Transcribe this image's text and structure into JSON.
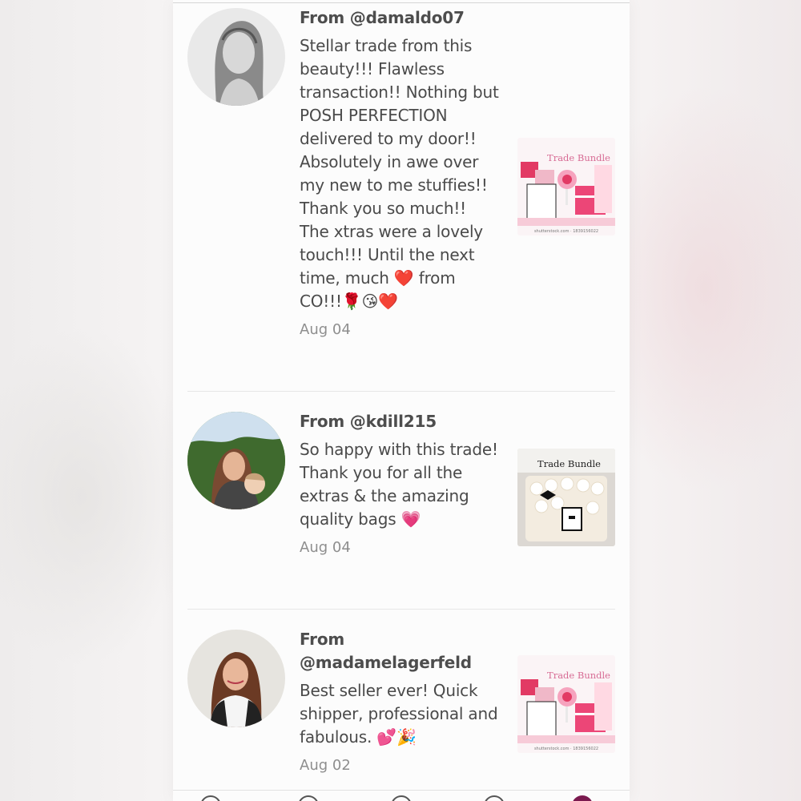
{
  "reviews": [
    {
      "from": "From @damaldo07",
      "body": "Stellar trade from this beauty!!! Flawless transaction!! Nothing but POSH PERFECTION delivered to my door!! Absolutely in awe over my new to me stuffies!! Thank you so much!! The xtras were a lovely touch!!! Until the next time, much ❤️ from CO!!!🌹😘❤️",
      "date": "Aug 04",
      "thumb_label": "Trade Bundle",
      "thumb_caption": "shutterstock.com · 1839156022"
    },
    {
      "from": "From @kdill215",
      "body": "So happy with this trade! Thank you for all the extras & the amazing quality bags 💗",
      "date": "Aug 04",
      "thumb_label": "Trade Bundle"
    },
    {
      "from": "From @madamelagerfeld",
      "body": "Best seller ever! Quick shipper, professional and fabulous. 💕🎉",
      "date": "Aug 02",
      "thumb_label": "Trade Bundle",
      "thumb_caption": "shutterstock.com · 1839156022"
    }
  ],
  "nav": {
    "icons": [
      "home-icon",
      "search-icon",
      "sell-icon",
      "news-icon",
      "profile-icon"
    ],
    "active_color": "#7b1a4f"
  }
}
